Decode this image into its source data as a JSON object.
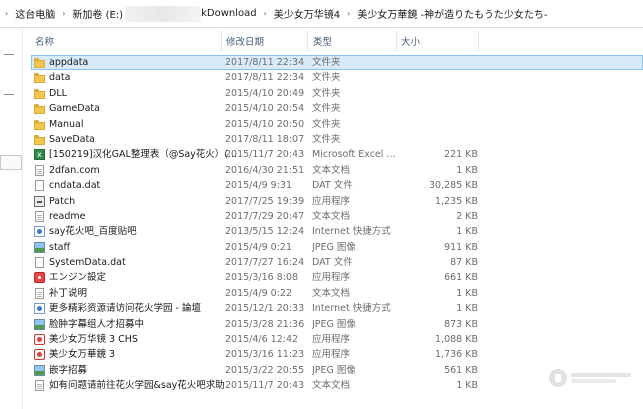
{
  "breadcrumb": {
    "seg1": "这台电脑",
    "seg2": "新加卷 (E:)",
    "seg3": "kDownload",
    "seg4": "美少女万华镜4",
    "seg5": "美少女万華鏡 -神が造りたもうた少女たち-"
  },
  "columns": {
    "name": "名称",
    "date": "修改日期",
    "type": "类型",
    "size": "大小"
  },
  "files": [
    {
      "name": "appdata",
      "date": "2017/8/11 22:34",
      "type": "文件夹",
      "size": "",
      "icon": "folder-icon"
    },
    {
      "name": "data",
      "date": "2017/8/11 22:34",
      "type": "文件夹",
      "size": "",
      "icon": "folder-icon"
    },
    {
      "name": "DLL",
      "date": "2015/4/10 20:49",
      "type": "文件夹",
      "size": "",
      "icon": "folder-icon"
    },
    {
      "name": "GameData",
      "date": "2015/4/10 20:54",
      "type": "文件夹",
      "size": "",
      "icon": "folder-icon"
    },
    {
      "name": "Manual",
      "date": "2015/4/10 20:50",
      "type": "文件夹",
      "size": "",
      "icon": "folder-icon"
    },
    {
      "name": "SaveData",
      "date": "2017/8/11 18:07",
      "type": "文件夹",
      "size": "",
      "icon": "folder-icon"
    },
    {
      "name": "[150219]汉化GAL整理表（@Say花火）(...",
      "date": "2015/11/7 20:43",
      "type": "Microsoft Excel ...",
      "size": "221 KB",
      "icon": "excel-icon"
    },
    {
      "name": "2dfan.com",
      "date": "2016/4/30 21:51",
      "type": "文本文档",
      "size": "1 KB",
      "icon": "text-document-icon"
    },
    {
      "name": "cndata.dat",
      "date": "2015/4/9 9:31",
      "type": "DAT 文件",
      "size": "30,285 KB",
      "icon": "dat-file-icon"
    },
    {
      "name": "Patch",
      "date": "2017/7/25 19:39",
      "type": "应用程序",
      "size": "1,235 KB",
      "icon": "application-icon"
    },
    {
      "name": "readme",
      "date": "2017/7/29 20:47",
      "type": "文本文档",
      "size": "2 KB",
      "icon": "text-document-icon"
    },
    {
      "name": "say花火吧_百度贴吧",
      "date": "2013/5/15 12:24",
      "type": "Internet 快捷方式",
      "size": "1 KB",
      "icon": "internet-shortcut-icon"
    },
    {
      "name": "staff",
      "date": "2015/4/9 0:21",
      "type": "JPEG 图像",
      "size": "911 KB",
      "icon": "jpeg-image-icon"
    },
    {
      "name": "SystemData.dat",
      "date": "2017/7/27 16:24",
      "type": "DAT 文件",
      "size": "87 KB",
      "icon": "dat-file-icon"
    },
    {
      "name": "エンジン設定",
      "date": "2015/3/16 8:08",
      "type": "应用程序",
      "size": "661 KB",
      "icon": "settings-app-icon"
    },
    {
      "name": "补丁说明",
      "date": "2015/4/9 0:22",
      "type": "文本文档",
      "size": "1 KB",
      "icon": "text-document-icon"
    },
    {
      "name": "更多精彩资源请访问花火学园 - 論壇",
      "date": "2015/12/1 20:33",
      "type": "Internet 快捷方式",
      "size": "1 KB",
      "icon": "internet-shortcut-icon"
    },
    {
      "name": "脸肿字幕组人才招募中",
      "date": "2015/3/28 21:36",
      "type": "JPEG 图像",
      "size": "873 KB",
      "icon": "jpeg-image-icon"
    },
    {
      "name": "美少女万华镜 3 CHS",
      "date": "2015/4/6 12:42",
      "type": "应用程序",
      "size": "1,088 KB",
      "icon": "game-app-icon"
    },
    {
      "name": "美少女万華鏡 3",
      "date": "2015/3/16 11:23",
      "type": "应用程序",
      "size": "1,736 KB",
      "icon": "game-app-icon"
    },
    {
      "name": "嵌字招募",
      "date": "2015/3/22 20:55",
      "type": "JPEG 图像",
      "size": "561 KB",
      "icon": "jpeg-image-icon"
    },
    {
      "name": "如有问题请前往花火学园&say花火吧求助",
      "date": "2015/11/7 20:43",
      "type": "文本文档",
      "size": "1 KB",
      "icon": "text-document-icon"
    }
  ]
}
